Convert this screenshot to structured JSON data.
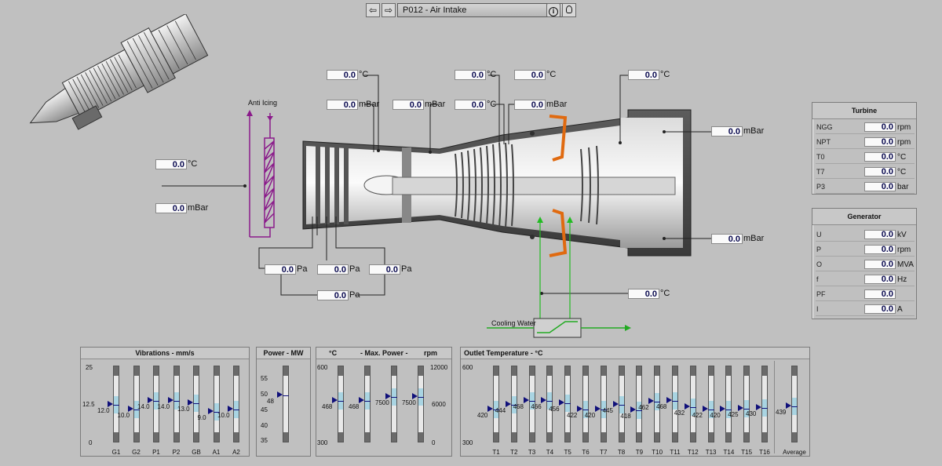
{
  "nav": {
    "back_icon": "back-arrow-icon",
    "forward_icon": "forward-arrow-icon",
    "title": "P012  - Air Intake",
    "info_icon": "info-icon",
    "hint_icon": "lightbulb-icon"
  },
  "diagram": {
    "anti_icing_label": "Anti Icing",
    "cooling_water_label": "Cooling Water",
    "ambient_temp": {
      "value": "0.0",
      "unit": "°C"
    },
    "ambient_press": {
      "value": "0.0",
      "unit": "mBar"
    },
    "intake_temp": {
      "value": "0.0",
      "unit": "°C"
    },
    "intake_press_1": {
      "value": "0.0",
      "unit": "mBar"
    },
    "intake_press_2": {
      "value": "0.0",
      "unit": "mBar"
    },
    "comp_temp_top": {
      "value": "0.0",
      "unit": "°C"
    },
    "comp_temp_top2": {
      "value": "0.0",
      "unit": "°C"
    },
    "comp_temp_mid": {
      "value": "0.0",
      "unit": "°C"
    },
    "comp_press_mid": {
      "value": "0.0",
      "unit": "mBar"
    },
    "exhaust_temp": {
      "value": "0.0",
      "unit": "°C"
    },
    "exhaust_press_top": {
      "value": "0.0",
      "unit": "mBar"
    },
    "exhaust_press_bot": {
      "value": "0.0",
      "unit": "mBar"
    },
    "filter_dp_1": {
      "value": "0.0",
      "unit": "Pa"
    },
    "filter_dp_2": {
      "value": "0.0",
      "unit": "Pa"
    },
    "filter_dp_3": {
      "value": "0.0",
      "unit": "Pa"
    },
    "filter_dp_total": {
      "value": "0.0",
      "unit": "Pa"
    },
    "cooling_temp": {
      "value": "0.0",
      "unit": "°C"
    },
    "colors": {
      "pipe": "#8a1a8a",
      "water": "#22bb22",
      "burner": "#e06a10",
      "value_text": "#0a0a50"
    }
  },
  "turbine": {
    "title": "Turbine",
    "rows": [
      {
        "label": "NGG",
        "value": "0.0",
        "unit": "rpm"
      },
      {
        "label": "NPT",
        "value": "0.0",
        "unit": "rpm"
      },
      {
        "label": "T0",
        "value": "0.0",
        "unit": "°C"
      },
      {
        "label": "T7",
        "value": "0.0",
        "unit": "°C"
      },
      {
        "label": "P3",
        "value": "0.0",
        "unit": "bar"
      }
    ]
  },
  "generator": {
    "title": "Generator",
    "rows": [
      {
        "label": "U",
        "value": "0.0",
        "unit": "kV"
      },
      {
        "label": "P",
        "value": "0.0",
        "unit": "rpm"
      },
      {
        "label": "O",
        "value": "0.0",
        "unit": "MVA"
      },
      {
        "label": "f",
        "value": "0.0",
        "unit": "Hz"
      },
      {
        "label": "PF",
        "value": "0.0",
        "unit": ""
      },
      {
        "label": "I",
        "value": "0.0",
        "unit": "A"
      }
    ]
  },
  "vibrations": {
    "title": "Vibrations - mm/s",
    "scale": {
      "max": "25",
      "mid": "12.5",
      "min": "0"
    },
    "range": [
      0,
      25
    ],
    "bars": [
      {
        "label": "G1",
        "value": 12.0,
        "text": "12.0"
      },
      {
        "label": "G2",
        "value": 10.0,
        "text": "10.0"
      },
      {
        "label": "P1",
        "value": 14.0,
        "text": "14.0"
      },
      {
        "label": "P2",
        "value": 14.0,
        "text": "14.0"
      },
      {
        "label": "GB",
        "value": 13.0,
        "text": "13.0"
      },
      {
        "label": "A1",
        "value": 9.0,
        "text": "9.0"
      },
      {
        "label": "A2",
        "value": 10.0,
        "text": "10.0"
      }
    ]
  },
  "power": {
    "title": "Power - MW",
    "scale": {
      "t1": "55",
      "t2": "50",
      "t3": "45",
      "t4": "40",
      "t5": "35"
    },
    "range": [
      35,
      55
    ],
    "value": 48,
    "text": "48"
  },
  "maxpower": {
    "title": "- Max. Power -",
    "left_unit": "°C",
    "right_unit": "rpm",
    "left_scale": {
      "max": "600",
      "min": "300"
    },
    "right_scale": {
      "max": "12000",
      "mid": "6000",
      "min": "0"
    },
    "bars": [
      {
        "value": 468,
        "text": "468",
        "range": [
          300,
          600
        ]
      },
      {
        "value": 468,
        "text": "468",
        "range": [
          300,
          600
        ]
      },
      {
        "value": 7500,
        "text": "7500",
        "range": [
          0,
          12000
        ]
      },
      {
        "value": 7500,
        "text": "7500",
        "range": [
          0,
          12000
        ]
      }
    ]
  },
  "outlet": {
    "title": "Outlet Temperature - °C",
    "scale": {
      "max": "600",
      "min": "300"
    },
    "range": [
      300,
      600
    ],
    "bars": [
      {
        "label": "T1",
        "value": 420,
        "text": "420"
      },
      {
        "label": "T2",
        "value": 444,
        "text": "444"
      },
      {
        "label": "T3",
        "value": 468,
        "text": "468"
      },
      {
        "label": "T4",
        "value": 466,
        "text": "466"
      },
      {
        "label": "T5",
        "value": 456,
        "text": "456"
      },
      {
        "label": "T6",
        "value": 422,
        "text": "422"
      },
      {
        "label": "T7",
        "value": 420,
        "text": "420"
      },
      {
        "label": "T8",
        "value": 445,
        "text": "445"
      },
      {
        "label": "T9",
        "value": 418,
        "text": "418"
      },
      {
        "label": "T10",
        "value": 462,
        "text": "462"
      },
      {
        "label": "T11",
        "value": 468,
        "text": "468"
      },
      {
        "label": "T12",
        "value": 432,
        "text": "432"
      },
      {
        "label": "T13",
        "value": 422,
        "text": "422"
      },
      {
        "label": "T14",
        "value": 420,
        "text": "420"
      },
      {
        "label": "T15",
        "value": 425,
        "text": "425"
      },
      {
        "label": "T16",
        "value": 430,
        "text": "430"
      }
    ],
    "average": {
      "label": "Average",
      "value": 439,
      "text": "439"
    }
  }
}
